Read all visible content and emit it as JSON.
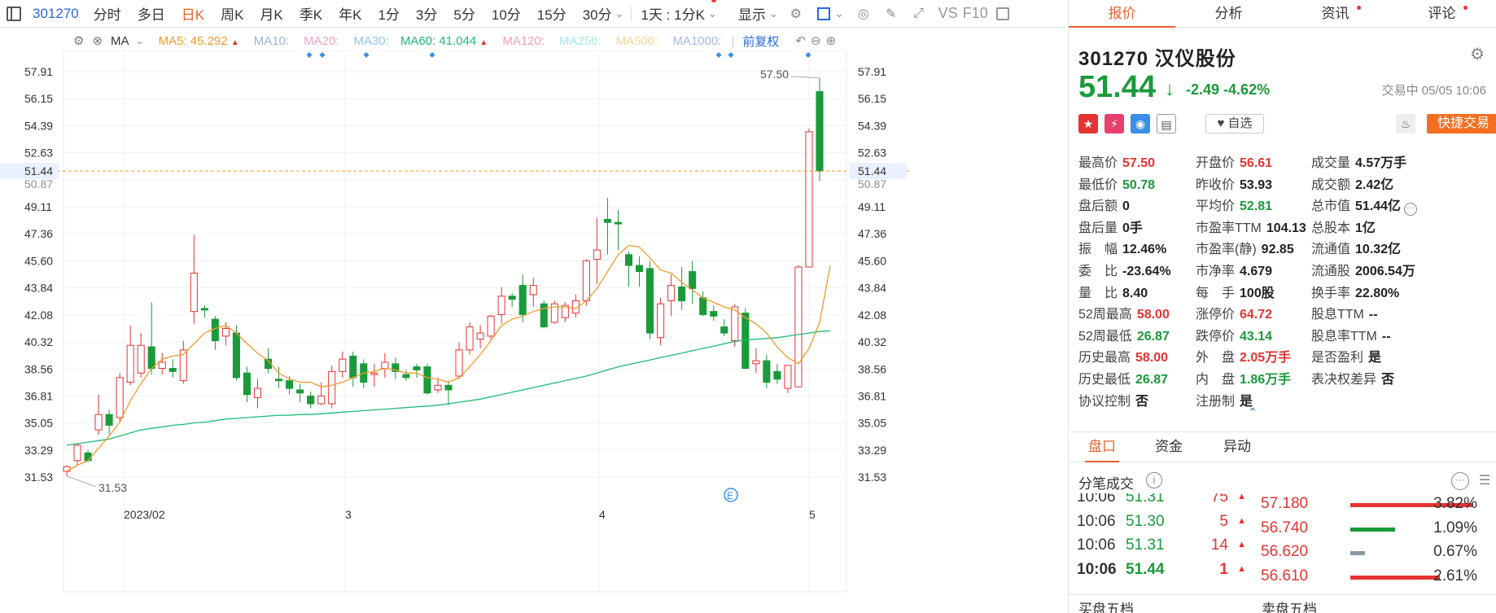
{
  "toolbar": {
    "code": "301270",
    "timeframes": [
      "分时",
      "多日",
      "日K",
      "周K",
      "月K",
      "季K",
      "年K",
      "1分",
      "3分",
      "5分",
      "10分",
      "15分",
      "30分"
    ],
    "active_timeframe": "日K",
    "range_select": "1天 : 1分K",
    "display_label": "显示",
    "vs_label": "VS",
    "f10_label": "F10"
  },
  "ma_bar": {
    "type_label": "MA",
    "ma5_label": "MA5:",
    "ma5_value": "45.292",
    "ma10_label": "MA10:",
    "ma20_label": "MA20:",
    "ma30_label": "MA30:",
    "ma60_label": "MA60:",
    "ma60_value": "41.044",
    "ma120_label": "MA120:",
    "ma250_label": "MA250:",
    "ma500_label": "MA500:",
    "ma1000_label": "MA1000:",
    "adjust_label": "前复权",
    "colors": {
      "ma5": "#f39a2b",
      "ma10": "#9bb3d9",
      "ma20": "#f2a0c8",
      "ma30": "#8ec7f2",
      "ma60": "#1fbb75",
      "ma120": "#f4a0b0",
      "ma250": "#a8e6e6",
      "ma500": "#f5d59a",
      "ma1000": "#a9b8e8"
    }
  },
  "chart_data": {
    "type": "candlestick",
    "y_ticks": [
      "57.91",
      "56.15",
      "54.39",
      "52.63",
      "50.87",
      "49.11",
      "47.36",
      "45.60",
      "43.84",
      "42.08",
      "40.32",
      "38.56",
      "36.81",
      "35.05",
      "33.29",
      "31.53"
    ],
    "x_ticks": [
      "2023/02",
      "3",
      "4",
      "5"
    ],
    "current_price_label": "51.44",
    "high_annotation": "57.50",
    "low_annotation": "31.53",
    "ylim": [
      30.5,
      58.6
    ],
    "candles": [
      [
        31.9,
        32.2,
        31.6,
        32.3
      ],
      [
        32.6,
        33.6,
        32.3,
        33.7
      ],
      [
        33.1,
        32.6,
        32.5,
        33.3
      ],
      [
        34.6,
        35.6,
        34.3,
        36.9
      ],
      [
        35.6,
        34.9,
        34.3,
        35.9
      ],
      [
        35.4,
        38.0,
        35.1,
        38.3
      ],
      [
        37.7,
        40.1,
        37.5,
        41.4
      ],
      [
        38.3,
        40.1,
        38.0,
        40.9
      ],
      [
        40.0,
        38.6,
        38.2,
        42.9
      ],
      [
        38.6,
        39.0,
        38.2,
        39.6
      ],
      [
        38.6,
        38.4,
        38.0,
        39.2
      ],
      [
        37.8,
        39.8,
        37.6,
        40.4
      ],
      [
        42.3,
        44.8,
        41.5,
        47.3
      ],
      [
        42.5,
        42.4,
        41.9,
        42.7
      ],
      [
        41.8,
        40.4,
        39.8,
        42.0
      ],
      [
        40.7,
        41.2,
        40.1,
        41.6
      ],
      [
        40.9,
        38.0,
        37.8,
        41.4
      ],
      [
        38.3,
        36.9,
        36.4,
        38.7
      ],
      [
        36.7,
        37.3,
        36.0,
        37.9
      ],
      [
        39.2,
        38.6,
        38.3,
        39.9
      ],
      [
        37.9,
        37.8,
        37.3,
        38.7
      ],
      [
        37.8,
        37.3,
        36.9,
        38.1
      ],
      [
        37.2,
        37.0,
        36.4,
        37.6
      ],
      [
        36.8,
        36.3,
        36.0,
        37.1
      ],
      [
        36.3,
        36.8,
        36.2,
        37.7
      ],
      [
        36.3,
        38.4,
        36.0,
        38.8
      ],
      [
        38.4,
        39.2,
        38.0,
        39.7
      ],
      [
        39.4,
        38.0,
        37.4,
        39.7
      ],
      [
        38.9,
        37.7,
        37.3,
        39.2
      ],
      [
        38.2,
        38.3,
        37.4,
        38.9
      ],
      [
        38.6,
        39.0,
        38.0,
        39.6
      ],
      [
        38.9,
        38.4,
        37.9,
        39.3
      ],
      [
        38.2,
        38.0,
        37.8,
        38.5
      ],
      [
        38.7,
        38.5,
        38.0,
        38.9
      ],
      [
        38.7,
        37.0,
        36.9,
        38.9
      ],
      [
        37.2,
        37.5,
        37.0,
        38.0
      ],
      [
        37.5,
        37.2,
        36.2,
        37.8
      ],
      [
        38.1,
        39.8,
        37.9,
        40.3
      ],
      [
        39.8,
        41.3,
        39.5,
        41.6
      ],
      [
        40.5,
        40.9,
        39.9,
        41.4
      ],
      [
        40.7,
        42.0,
        40.5,
        42.1
      ],
      [
        42.1,
        43.3,
        41.5,
        43.9
      ],
      [
        43.3,
        43.1,
        42.6,
        43.5
      ],
      [
        44.0,
        42.1,
        41.6,
        44.7
      ],
      [
        43.4,
        44.0,
        42.6,
        44.5
      ],
      [
        42.8,
        41.3,
        41.2,
        43.0
      ],
      [
        41.6,
        42.8,
        41.5,
        43.0
      ],
      [
        41.9,
        42.7,
        41.6,
        42.9
      ],
      [
        42.2,
        43.0,
        41.9,
        43.4
      ],
      [
        43.0,
        45.6,
        42.7,
        45.7
      ],
      [
        45.7,
        46.3,
        44.1,
        48.4
      ],
      [
        48.3,
        48.1,
        46.0,
        49.7
      ],
      [
        48.1,
        48.0,
        46.3,
        48.9
      ],
      [
        46.0,
        45.3,
        43.9,
        46.2
      ],
      [
        45.3,
        44.9,
        43.9,
        45.9
      ],
      [
        45.1,
        40.9,
        40.5,
        45.6
      ],
      [
        40.6,
        42.8,
        40.1,
        43.2
      ],
      [
        43.0,
        44.0,
        42.0,
        44.7
      ],
      [
        43.9,
        43.0,
        42.4,
        45.2
      ],
      [
        44.9,
        43.8,
        42.8,
        45.6
      ],
      [
        43.2,
        42.1,
        42.0,
        43.6
      ],
      [
        42.3,
        42.0,
        41.7,
        42.7
      ],
      [
        41.3,
        40.9,
        40.7,
        41.8
      ],
      [
        40.4,
        42.6,
        40.0,
        42.8
      ],
      [
        42.2,
        38.6,
        38.6,
        42.5
      ],
      [
        38.9,
        39.1,
        38.3,
        39.9
      ],
      [
        39.1,
        37.7,
        37.3,
        39.5
      ],
      [
        38.4,
        37.9,
        37.6,
        38.9
      ],
      [
        37.3,
        38.8,
        37.0,
        38.8
      ],
      [
        37.4,
        45.2,
        37.4,
        45.3
      ],
      [
        45.2,
        54.0,
        45.2,
        54.2
      ],
      [
        56.61,
        51.44,
        50.78,
        57.5
      ]
    ],
    "ma5": [
      31.9,
      32.3,
      32.6,
      33.4,
      34.2,
      35.1,
      36.5,
      37.6,
      38.6,
      39.2,
      39.4,
      39.5,
      40.2,
      40.9,
      41.2,
      41.4,
      40.9,
      40.2,
      39.6,
      39.1,
      38.3,
      37.9,
      37.7,
      37.7,
      37.4,
      37.5,
      37.7,
      38.0,
      38.3,
      38.4,
      38.6,
      38.5,
      38.3,
      38.3,
      38.0,
      37.9,
      37.7,
      38.0,
      38.7,
      39.5,
      40.4,
      41.4,
      41.8,
      42.0,
      42.3,
      42.5,
      42.6,
      42.6,
      42.5,
      43.0,
      43.8,
      44.9,
      46.0,
      46.6,
      46.5,
      45.8,
      45.0,
      44.8,
      44.2,
      43.7,
      43.2,
      42.9,
      42.6,
      42.4,
      41.9,
      41.5,
      40.9,
      40.0,
      39.3,
      38.9,
      39.9,
      41.6,
      45.3
    ],
    "ma60": [
      33.6,
      33.7,
      33.8,
      33.9,
      34.0,
      34.2,
      34.4,
      34.6,
      34.7,
      34.8,
      34.9,
      34.95,
      35.05,
      35.1,
      35.2,
      35.3,
      35.35,
      35.4,
      35.45,
      35.5,
      35.55,
      35.55,
      35.6,
      35.6,
      35.65,
      35.7,
      35.75,
      35.8,
      35.85,
      35.9,
      35.95,
      36.0,
      36.05,
      36.1,
      36.15,
      36.2,
      36.3,
      36.4,
      36.5,
      36.6,
      36.75,
      36.9,
      37.05,
      37.2,
      37.35,
      37.5,
      37.65,
      37.8,
      37.95,
      38.1,
      38.3,
      38.5,
      38.7,
      38.85,
      39.0,
      39.15,
      39.3,
      39.45,
      39.6,
      39.75,
      39.9,
      40.05,
      40.2,
      40.35,
      40.45,
      40.5,
      40.55,
      40.6,
      40.7,
      40.8,
      40.9,
      41.0,
      41.044
    ]
  },
  "quote": {
    "code": "301270",
    "name": "汉仪股份",
    "price": "51.44",
    "change": "-2.49",
    "change_pct": "-4.62%",
    "trade_status": "交易中 05/05 10:06",
    "fav_label": "自选",
    "quick_trade_label": "快捷交易",
    "rows": [
      [
        {
          "l": "最高价",
          "v": "57.50",
          "c": "red"
        },
        {
          "l": "开盘价",
          "v": "56.61",
          "c": "red"
        },
        {
          "l": "成交量",
          "v": "4.57万手",
          "c": "dark"
        }
      ],
      [
        {
          "l": "最低价",
          "v": "50.78",
          "c": "green"
        },
        {
          "l": "昨收价",
          "v": "53.93",
          "c": "dark"
        },
        {
          "l": "成交额",
          "v": "2.42亿",
          "c": "dark"
        }
      ],
      [
        {
          "l": "盘后额",
          "v": "0",
          "c": "dark"
        },
        {
          "l": "平均价",
          "v": "52.81",
          "c": "green"
        },
        {
          "l": "总市值",
          "v": "51.44亿",
          "c": "dark"
        }
      ],
      [
        {
          "l": "盘后量",
          "v": "0手",
          "c": "dark"
        },
        {
          "l": "市盈率TTM",
          "v": "104.13",
          "c": "dark"
        },
        {
          "l": "总股本",
          "v": "1亿",
          "c": "dark"
        }
      ],
      [
        {
          "l": "振　幅",
          "v": "12.46%",
          "c": "dark"
        },
        {
          "l": "市盈率(静)",
          "v": "92.85",
          "c": "dark"
        },
        {
          "l": "流通值",
          "v": "10.32亿",
          "c": "dark"
        }
      ],
      [
        {
          "l": "委　比",
          "v": "-23.64%",
          "c": "dark"
        },
        {
          "l": "市净率",
          "v": "4.679",
          "c": "dark"
        },
        {
          "l": "流通股",
          "v": "2006.54万",
          "c": "dark"
        }
      ],
      [
        {
          "l": "量　比",
          "v": "8.40",
          "c": "dark"
        },
        {
          "l": "每　手",
          "v": "100股",
          "c": "dark"
        },
        {
          "l": "换手率",
          "v": "22.80%",
          "c": "dark"
        }
      ],
      [
        {
          "l": "52周最高",
          "v": "58.00",
          "c": "red"
        },
        {
          "l": "涨停价",
          "v": "64.72",
          "c": "red"
        },
        {
          "l": "股息TTM",
          "v": "--",
          "c": "dark"
        }
      ],
      [
        {
          "l": "52周最低",
          "v": "26.87",
          "c": "green"
        },
        {
          "l": "跌停价",
          "v": "43.14",
          "c": "green"
        },
        {
          "l": "股息率TTM",
          "v": "--",
          "c": "dark"
        }
      ],
      [
        {
          "l": "历史最高",
          "v": "58.00",
          "c": "red"
        },
        {
          "l": "外　盘",
          "v": "2.05万手",
          "c": "red"
        },
        {
          "l": "是否盈利",
          "v": "是",
          "c": "dark"
        }
      ],
      [
        {
          "l": "历史最低",
          "v": "26.87",
          "c": "green"
        },
        {
          "l": "内　盘",
          "v": "1.86万手",
          "c": "green"
        },
        {
          "l": "表决权差异",
          "v": "否",
          "c": "dark"
        }
      ],
      [
        {
          "l": "协议控制",
          "v": "否",
          "c": "dark"
        },
        {
          "l": "注册制",
          "v": "是",
          "c": "dark"
        },
        {
          "l": "",
          "v": "",
          "c": "dark"
        }
      ]
    ]
  },
  "right_tabs": [
    "报价",
    "分析",
    "资讯",
    "评论"
  ],
  "bottom_tabs": [
    "盘口",
    "资金",
    "异动"
  ],
  "trades_title": "分笔成交",
  "trades": [
    {
      "time": "10:06",
      "price": "51.31",
      "vol": "75"
    },
    {
      "time": "10:06",
      "price": "51.30",
      "vol": "5"
    },
    {
      "time": "10:06",
      "price": "51.31",
      "vol": "14"
    },
    {
      "time": "10:06",
      "price": "51.44",
      "vol": "1"
    }
  ],
  "levels": [
    {
      "price": "57.180",
      "pct": "3.82%",
      "color": "#e53333",
      "w": 150
    },
    {
      "price": "56.740",
      "pct": "1.09%",
      "color": "#1a9a3a",
      "w": 55
    },
    {
      "price": "56.620",
      "pct": "0.67%",
      "color": "#8a95a5",
      "w": 18
    },
    {
      "price": "56.610",
      "pct": "2.61%",
      "color": "#e53333",
      "w": 110
    }
  ],
  "book_labels": {
    "buy": "买盘五档",
    "sell": "卖盘五档"
  },
  "colors": {
    "up": "#e53333",
    "down": "#1a9a3a",
    "accent": "#e8632d",
    "ma5": "#f39a2b",
    "ma60": "#1fbb75"
  }
}
